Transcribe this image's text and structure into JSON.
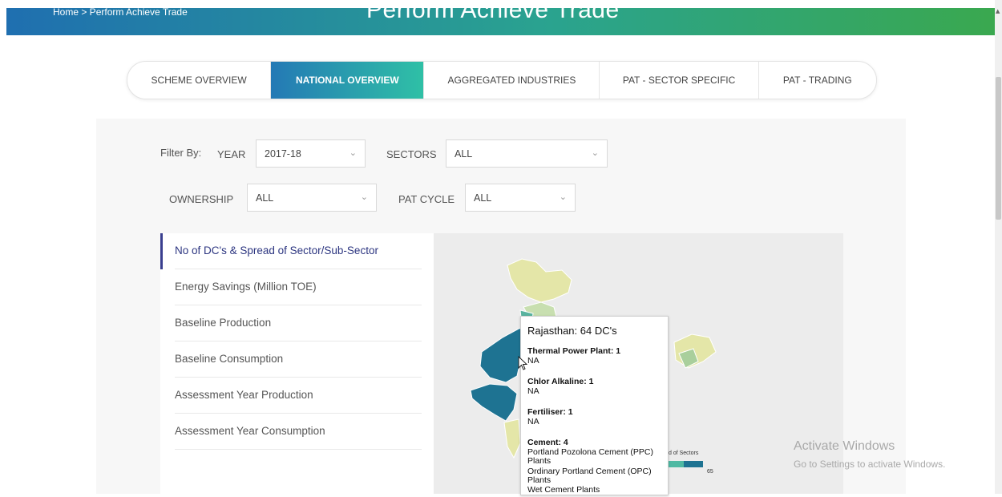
{
  "header": {
    "breadcrumb": "Home > Perform Achieve Trade",
    "title": "Perform Achieve Trade"
  },
  "tabs": [
    {
      "label": "SCHEME OVERVIEW",
      "active": false
    },
    {
      "label": "NATIONAL OVERVIEW",
      "active": true
    },
    {
      "label": "AGGREGATED INDUSTRIES",
      "active": false
    },
    {
      "label": "PAT - SECTOR SPECIFIC",
      "active": false
    },
    {
      "label": "PAT - TRADING",
      "active": false
    }
  ],
  "filters": {
    "filter_by_label": "Filter By:",
    "year_label": "YEAR",
    "year_value": "2017-18",
    "sectors_label": "SECTORS",
    "sectors_value": "ALL",
    "ownership_label": "OWNERSHIP",
    "ownership_value": "ALL",
    "pat_cycle_label": "PAT CYCLE",
    "pat_cycle_value": "ALL"
  },
  "menu": {
    "items": [
      {
        "label": "No of DC's & Spread of Sector/Sub-Sector",
        "active": true
      },
      {
        "label": "Energy Savings (Million TOE)",
        "active": false
      },
      {
        "label": "Baseline Production",
        "active": false
      },
      {
        "label": "Baseline Consumption",
        "active": false
      },
      {
        "label": "Assessment Year Production",
        "active": false
      },
      {
        "label": "Assessment Year Consumption",
        "active": false
      }
    ]
  },
  "tooltip": {
    "title": "Rajasthan: 64 DC's",
    "lines": [
      "Thermal Power Plant: 1",
      "NA",
      "Chlor Alkaline: 1",
      "NA",
      "Fertiliser: 1",
      "NA",
      "Cement: 4",
      "Portland Pozolona Cement (PPC)",
      "Plants",
      "Ordinary Portland Cement (OPC)",
      "Plants",
      "Wet Cement Plants"
    ]
  },
  "legend": {
    "label": "d of Sectors",
    "max": "65"
  },
  "watermark": {
    "line1": "Activate Windows",
    "line2": "Go to Settings to activate Windows."
  },
  "colors": {
    "active_menu": "#2c3580",
    "tab_gradient_start": "#2479b5",
    "tab_gradient_end": "#2fc0a6",
    "map_highlight": "#1e7392",
    "map_light": "#e4e6a8"
  },
  "icons": [
    "chevron-down-icon",
    "mouse-pointer-icon",
    "scroll-up-icon"
  ]
}
